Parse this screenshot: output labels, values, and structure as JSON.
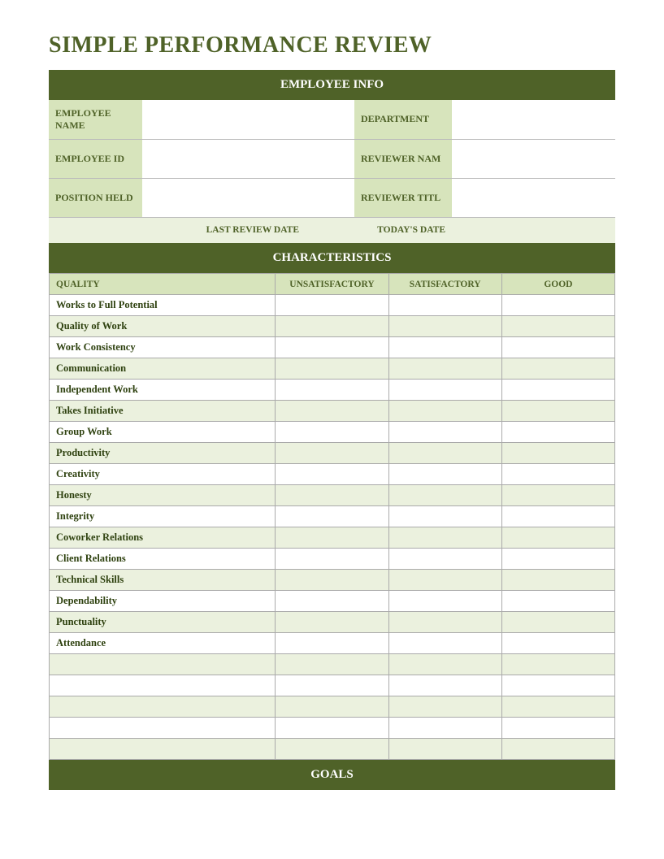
{
  "title": "SIMPLE PERFORMANCE REVIEW",
  "sections": {
    "employee_info": "EMPLOYEE INFO",
    "characteristics": "CHARACTERISTICS",
    "goals": "GOALS"
  },
  "employee_info": {
    "labels": {
      "name": "EMPLOYEE NAME",
      "department": "DEPARTMENT",
      "id": "EMPLOYEE ID",
      "reviewer_name": "REVIEWER NAM",
      "position": "POSITION HELD",
      "reviewer_title": "REVIEWER TITL",
      "last_review_date": "LAST REVIEW DATE",
      "todays_date": "TODAY'S DATE"
    },
    "values": {
      "name": "",
      "department": "",
      "id": "",
      "reviewer_name": "",
      "position": "",
      "reviewer_title": "",
      "last_review_date": "",
      "todays_date": ""
    }
  },
  "characteristics": {
    "columns": {
      "quality": "QUALITY",
      "unsatisfactory": "UNSATISFACTORY",
      "satisfactory": "SATISFACTORY",
      "good": "GOOD"
    },
    "rows": [
      "Works to Full Potential",
      "Quality of Work",
      "Work Consistency",
      "Communication",
      "Independent Work",
      "Takes Initiative",
      "Group Work",
      "Productivity",
      "Creativity",
      "Honesty",
      "Integrity",
      "Coworker Relations",
      "Client Relations",
      "Technical Skills",
      "Dependability",
      "Punctuality",
      "Attendance",
      "",
      "",
      "",
      "",
      ""
    ]
  }
}
